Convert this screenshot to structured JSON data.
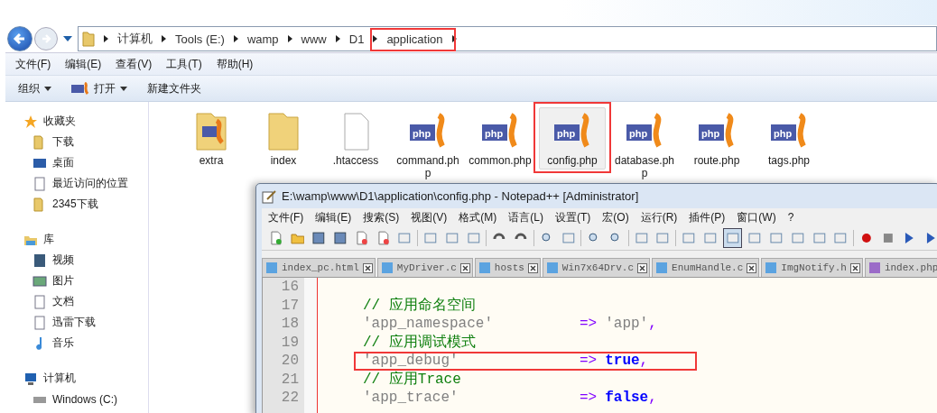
{
  "explorer": {
    "breadcrumbs": [
      {
        "label": "计算机",
        "highlighted": false
      },
      {
        "label": "Tools (E:)",
        "highlighted": false
      },
      {
        "label": "wamp",
        "highlighted": false
      },
      {
        "label": "www",
        "highlighted": false
      },
      {
        "label": "D1",
        "highlighted": false
      },
      {
        "label": "application",
        "highlighted": true
      }
    ],
    "menu": [
      "文件(F)",
      "编辑(E)",
      "查看(V)",
      "工具(T)",
      "帮助(H)"
    ],
    "toolbar": [
      {
        "label": "组织",
        "kind": "dropdown"
      },
      {
        "label": "打开",
        "kind": "open"
      },
      {
        "label": "新建文件夹",
        "kind": "plain"
      }
    ],
    "sidebar": [
      {
        "label": "收藏夹",
        "kind": "star",
        "children": [
          {
            "label": "下载",
            "kind": "download"
          },
          {
            "label": "桌面",
            "kind": "desktop"
          },
          {
            "label": "最近访问的位置",
            "kind": "recent"
          },
          {
            "label": "2345下载",
            "kind": "folder"
          }
        ]
      },
      {
        "label": "库",
        "kind": "library",
        "children": [
          {
            "label": "视频",
            "kind": "video"
          },
          {
            "label": "图片",
            "kind": "picture"
          },
          {
            "label": "文档",
            "kind": "document"
          },
          {
            "label": "迅雷下载",
            "kind": "document"
          },
          {
            "label": "音乐",
            "kind": "music"
          }
        ]
      },
      {
        "label": "计算机",
        "kind": "computer",
        "children": [
          {
            "label": "Windows (C:)",
            "kind": "drive"
          }
        ]
      }
    ],
    "files": [
      {
        "label": "extra",
        "kind": "folder-php",
        "selected": false,
        "highlighted": false
      },
      {
        "label": "index",
        "kind": "folder",
        "selected": false,
        "highlighted": false
      },
      {
        "label": ".htaccess",
        "kind": "file",
        "selected": false,
        "highlighted": false
      },
      {
        "label": "command.php",
        "kind": "php",
        "selected": false,
        "highlighted": false
      },
      {
        "label": "common.php",
        "kind": "php",
        "selected": false,
        "highlighted": false
      },
      {
        "label": "config.php",
        "kind": "php",
        "selected": true,
        "highlighted": true
      },
      {
        "label": "database.php",
        "kind": "php",
        "selected": false,
        "highlighted": false
      },
      {
        "label": "route.php",
        "kind": "php",
        "selected": false,
        "highlighted": false
      },
      {
        "label": "tags.php",
        "kind": "php",
        "selected": false,
        "highlighted": false
      }
    ]
  },
  "notepad": {
    "title": "E:\\wamp\\www\\D1\\application\\config.php - Notepad++ [Administrator]",
    "menu": [
      "文件(F)",
      "编辑(E)",
      "搜索(S)",
      "视图(V)",
      "格式(M)",
      "语言(L)",
      "设置(T)",
      "宏(O)",
      "运行(R)",
      "插件(P)",
      "窗口(W)",
      "?"
    ],
    "tabs": [
      {
        "label": "index_pc.html",
        "color": "#5ba3e0"
      },
      {
        "label": "MyDriver.c",
        "color": "#5ba3e0"
      },
      {
        "label": "hosts",
        "color": "#5ba3e0"
      },
      {
        "label": "Win7x64Drv.c",
        "color": "#5ba3e0"
      },
      {
        "label": "EnumHandle.c",
        "color": "#5ba3e0"
      },
      {
        "label": "ImgNotify.h",
        "color": "#5ba3e0"
      },
      {
        "label": "index.php",
        "color": "#9b6bc8"
      }
    ],
    "lines": [
      {
        "number": "16",
        "highlighted": false
      },
      {
        "number": "17",
        "highlighted": false,
        "segments": [
          {
            "text": "// 应用命名空间",
            "kind": "comment"
          }
        ]
      },
      {
        "number": "18",
        "highlighted": false,
        "segments": [
          {
            "text": "'app_namespace'",
            "kind": "string"
          },
          {
            "text": "=>",
            "kind": "operator"
          },
          {
            "text": "'app'",
            "kind": "string"
          },
          {
            "text": ",",
            "kind": "operator"
          }
        ]
      },
      {
        "number": "19",
        "highlighted": false,
        "segments": [
          {
            "text": "// 应用调试模式",
            "kind": "comment"
          }
        ]
      },
      {
        "number": "20",
        "highlighted": true,
        "segments": [
          {
            "text": "'app_debug'",
            "kind": "string"
          },
          {
            "text": "=>",
            "kind": "operator"
          },
          {
            "text": "true",
            "kind": "keyword"
          },
          {
            "text": ",",
            "kind": "operator"
          }
        ]
      },
      {
        "number": "21",
        "highlighted": false,
        "segments": [
          {
            "text": "// 应用Trace",
            "kind": "comment"
          }
        ]
      },
      {
        "number": "22",
        "highlighted": false,
        "segments": [
          {
            "text": "'app_trace'",
            "kind": "string"
          },
          {
            "text": "=>",
            "kind": "operator"
          },
          {
            "text": "false",
            "kind": "keyword"
          },
          {
            "text": ",",
            "kind": "operator"
          }
        ]
      }
    ]
  }
}
